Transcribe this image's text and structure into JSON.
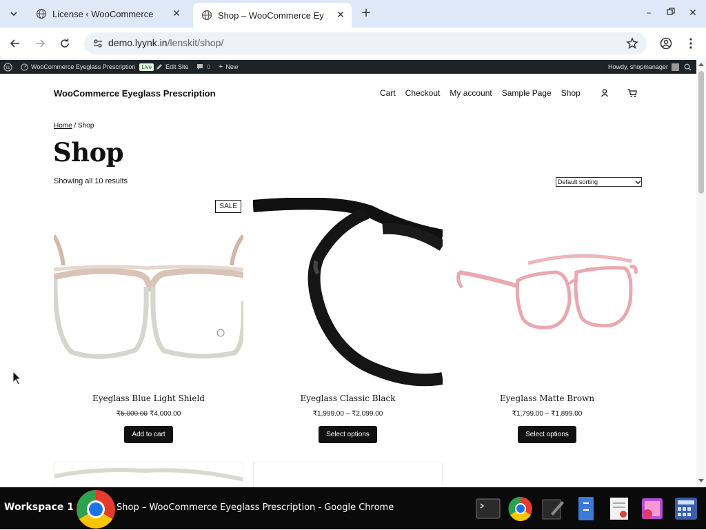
{
  "browser": {
    "tabs": [
      {
        "title": "License ‹ WooCommerce",
        "active": false
      },
      {
        "title": "Shop – WooCommerce Ey",
        "active": true
      }
    ],
    "url_host": "demo.lyynk.in",
    "url_path": "/lenskit/shop/"
  },
  "adminbar": {
    "site_name": "WooCommerce Eyeglass Prescription",
    "live_label": "Live",
    "edit_site": "Edit Site",
    "comments_count": "0",
    "new_label": "New",
    "howdy": "Howdy, shopmanager"
  },
  "site": {
    "title": "WooCommerce Eyeglass Prescription",
    "nav": [
      "Cart",
      "Checkout",
      "My account",
      "Sample Page",
      "Shop"
    ]
  },
  "breadcrumb": {
    "home": "Home",
    "separator": " / ",
    "current": "Shop"
  },
  "page_title": "Shop",
  "result_count": "Showing all 10 results",
  "sorting": {
    "selected": "Default sorting"
  },
  "products": [
    {
      "name": "Eyeglass Blue Light Shield",
      "badge": "SALE",
      "price_old": "₹5,000.00",
      "price": "₹4,000.00",
      "button": "Add to cart"
    },
    {
      "name": "Eyeglass Classic Black",
      "price": "₹1,999.00 – ₹2,099.00",
      "button": "Select options"
    },
    {
      "name": "Eyeglass Matte Brown",
      "price": "₹1,799.00 – ₹1,899.00",
      "button": "Select options"
    }
  ],
  "taskbar": {
    "workspace": "Workspace 1",
    "window_title": "Shop – WooCommerce Eyeglass Prescription - Google Chrome"
  }
}
